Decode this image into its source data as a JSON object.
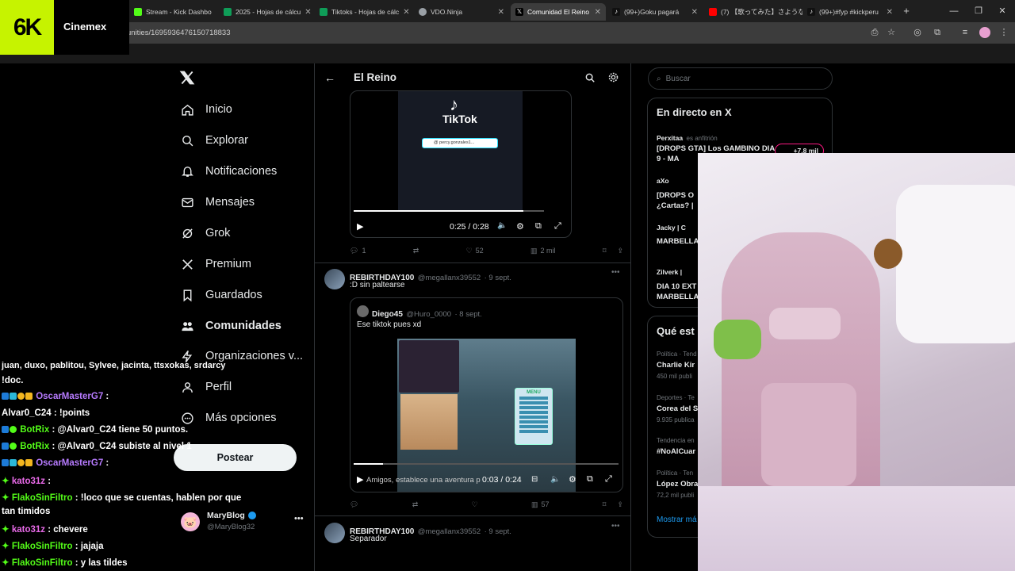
{
  "browser": {
    "tabs": [
      {
        "title": "Stream - Kick Dashbo",
        "color": "#53fc18"
      },
      {
        "title": "2025 - Hojas de cálcu",
        "color": "#0f9d58"
      },
      {
        "title": "Tiktoks - Hojas de cálc",
        "color": "#0f9d58"
      },
      {
        "title": "VDO.Ninja",
        "color": "#9aa0a6"
      },
      {
        "title": "Comunidad El Reino",
        "color": "#000000"
      },
      {
        "title": "(99+)Goku pagará",
        "color": "#000000"
      },
      {
        "title": "(7) 【歌ってみた】さようなら",
        "color": "#ff0000"
      },
      {
        "title": "(99+)#fyp #kickperu",
        "color": "#000000"
      }
    ],
    "url": "unities/1695936476150718833"
  },
  "overlay": {
    "logo_mark": "6K",
    "logo_name": "Cinemex"
  },
  "nav": {
    "items": [
      {
        "label": "Inicio",
        "icon": "home-icon"
      },
      {
        "label": "Explorar",
        "icon": "search-icon"
      },
      {
        "label": "Notificaciones",
        "icon": "bell-icon"
      },
      {
        "label": "Mensajes",
        "icon": "mail-icon"
      },
      {
        "label": "Grok",
        "icon": "grok-icon"
      },
      {
        "label": "Premium",
        "icon": "x-icon"
      },
      {
        "label": "Guardados",
        "icon": "bookmark-icon"
      },
      {
        "label": "Comunidades",
        "icon": "communities-icon"
      },
      {
        "label": "Organizaciones v...",
        "icon": "lightning-icon"
      },
      {
        "label": "Perfil",
        "icon": "person-icon"
      },
      {
        "label": "Más opciones",
        "icon": "more-icon"
      }
    ],
    "post_label": "Postear",
    "profile_name": "MaryBlog",
    "profile_handle": "@MaryBlog32"
  },
  "main": {
    "title": "El Reino",
    "video1": {
      "brand": "TikTok",
      "handle": "@ percy.gonzales1...",
      "time": "0:25 / 0:28",
      "progress": 0.89
    },
    "post1_actions": {
      "replies": "1",
      "likes": "52",
      "views": "2 mil"
    },
    "post2": {
      "name": "REBIRTHDAY100",
      "handle": "@megallanx39552",
      "date": "· 9 sept.",
      "text": ":D sin paltearse",
      "quote": {
        "name": "Diego45",
        "handle": "@Huro_0000",
        "date": "· 8 sept.",
        "text": "Ese tiktok pues xd"
      },
      "video2": {
        "caption": "Amigos, establece una aventura p",
        "time": "0:03 / 0:24",
        "progress": 0.11,
        "menu_title": "MENU"
      }
    },
    "post2_actions": {
      "views": "57"
    },
    "post3": {
      "name": "REBIRTHDAY100",
      "handle": "@megallanx39552",
      "date": "· 9 sept.",
      "text": "Separador"
    }
  },
  "right": {
    "search_placeholder": "Buscar",
    "live_title": "En directo en X",
    "live": [
      {
        "host": "Perxitaa",
        "note": "es anfitrión",
        "title": "[DROPS GTA] Los GAMBINO DIA 9 - MA",
        "count": "+7,8 mil"
      },
      {
        "host": "aXo",
        "title": "[DROPS O ¿Cartas? |"
      },
      {
        "host": "Jacky | C",
        "title": "MARBELLA"
      },
      {
        "host": "Zilverk |",
        "title": "DIA 10 EXT MARBELLA"
      }
    ],
    "trends_title": "Qué est",
    "trends": [
      {
        "context": "Política · Tend",
        "name": "Charlie Kir",
        "count": "450 mil publi"
      },
      {
        "context": "Deportes · Te",
        "name": "Corea del S",
        "count": "9.935 publica"
      },
      {
        "context": "Tendencia en",
        "name": "#NoAlCuar",
        "count": ""
      },
      {
        "context": "Política · Ten",
        "name": "López Obra",
        "count": "72,2 mil publi"
      }
    ],
    "show_more": "Mostrar má"
  },
  "chat": [
    {
      "user": "",
      "msg": "juan, duxo, pablitou, Sylvee, jacinta, ttsxokas, srdarcy"
    },
    {
      "user": "",
      "msg": "!doc."
    },
    {
      "user": "OscarMasterG7",
      "msg": " :",
      "color": "#b77bff"
    },
    {
      "user": "Alvar0_C24",
      "msg": " : !points",
      "color": "#ffffff"
    },
    {
      "user": "BotRix",
      "msg": " : @Alvar0_C24 tiene 50 puntos.",
      "color": "#53fc18"
    },
    {
      "user": "BotRix",
      "msg": " : @Alvar0_C24 subiste al nivel 1",
      "color": "#53fc18"
    },
    {
      "user": "OscarMasterG7",
      "msg": " :",
      "color": "#b77bff"
    },
    {
      "user": "kato31z",
      "msg": " :",
      "color": "#e86ae8"
    },
    {
      "user": "FlakoSinFiltro",
      "msg": " : !loco que se cuentas, hablen por que",
      "color": "#53fc18"
    },
    {
      "user": "",
      "msg": "tan timidos"
    },
    {
      "user": "kato31z",
      "msg": " : chevere",
      "color": "#e86ae8"
    },
    {
      "user": "FlakoSinFiltro",
      "msg": " : jajaja",
      "color": "#53fc18"
    },
    {
      "user": "FlakoSinFiltro",
      "msg": " : y las tildes",
      "color": "#53fc18"
    }
  ],
  "colors": {
    "accent": "#1d9bf0",
    "bg": "#000000",
    "border": "#2f3336",
    "kick_green": "#53fc18"
  }
}
